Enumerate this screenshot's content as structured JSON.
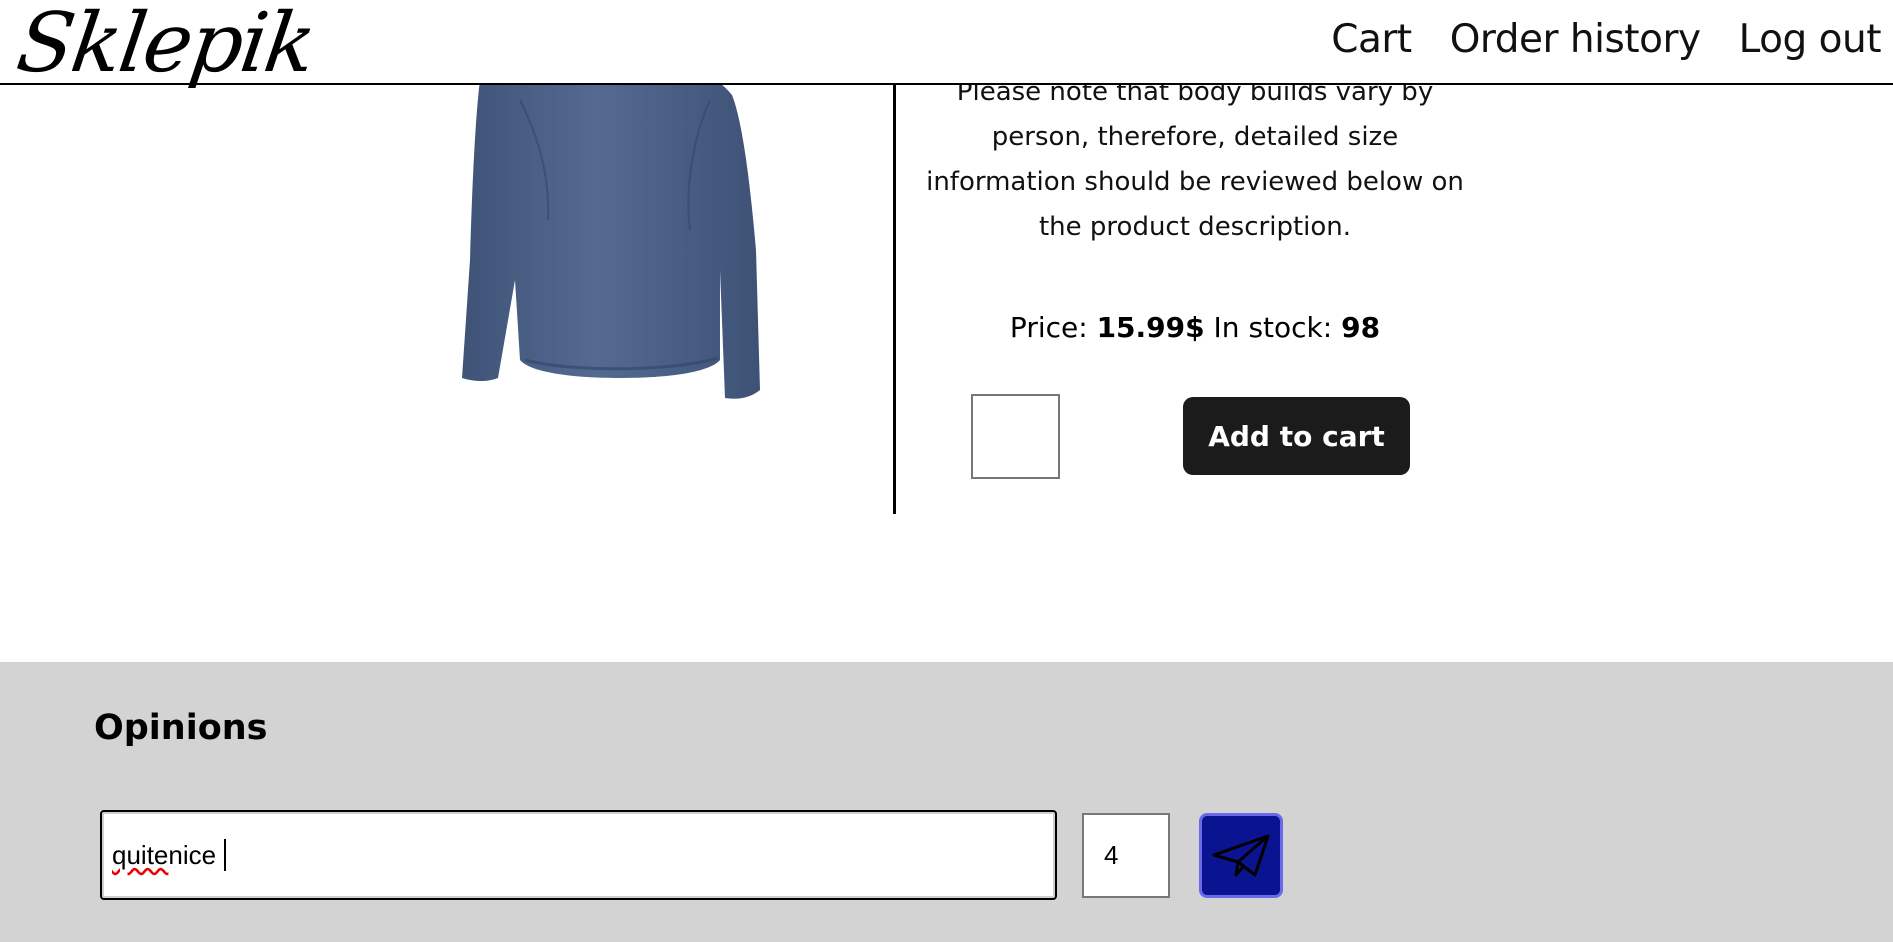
{
  "header": {
    "logo": "Sklepik",
    "nav": {
      "cart": "Cart",
      "order_history": "Order history",
      "logout": "Log out"
    }
  },
  "product": {
    "image_icon": "long-sleeve-shirt-image",
    "description_lines": [
      "Please note that body builds vary by",
      "person, therefore, detailed size",
      "information should be reviewed below on",
      "the product description."
    ],
    "price_label": "Price:",
    "price_value": "15.99$",
    "stock_label": "In stock:",
    "stock_value": "98",
    "quantity_value": "",
    "add_to_cart_label": "Add to cart"
  },
  "opinions": {
    "title": "Opinions",
    "input_word1": "quite",
    "input_rest": " nice",
    "rating_value": "4",
    "send_icon": "paper-plane-icon"
  },
  "colors": {
    "header_border": "#000000",
    "button_dark": "#1b1b1b",
    "send_button": "#0a1490",
    "opinions_bg": "#d3d3d3"
  }
}
